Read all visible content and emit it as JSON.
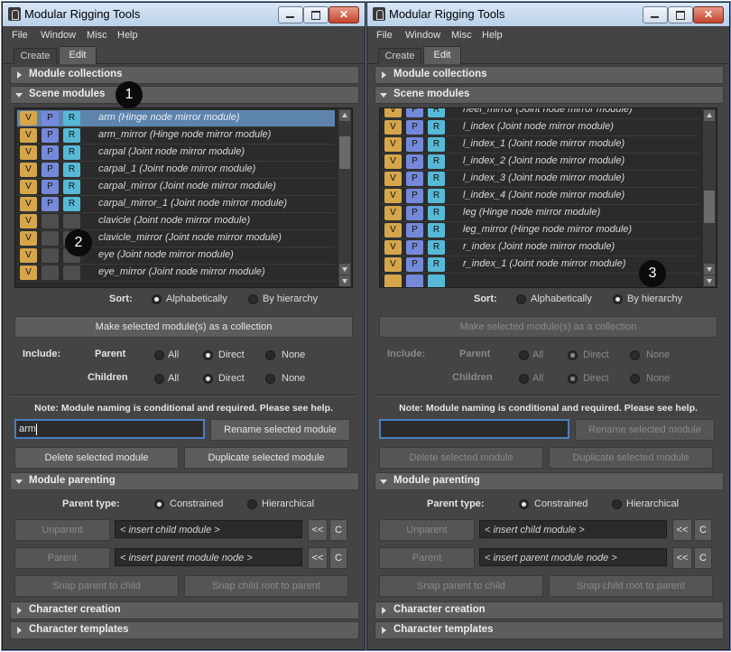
{
  "left": {
    "title": "Modular Rigging Tools",
    "menu": [
      "File",
      "Window",
      "Misc",
      "Help"
    ],
    "tabs": [
      "Create",
      "Edit"
    ],
    "sections": {
      "collections": "Module collections",
      "scene": "Scene modules",
      "parenting": "Module parenting",
      "creation": "Character creation",
      "templates": "Character templates"
    },
    "modules": [
      {
        "v": "V",
        "p": "P",
        "r": "R",
        "name": "arm (Hinge node mirror module)",
        "selected": true
      },
      {
        "v": "V",
        "p": "P",
        "r": "R",
        "name": "arm_mirror (Hinge node mirror module)"
      },
      {
        "v": "V",
        "p": "P",
        "r": "R",
        "name": "carpal (Joint node mirror module)"
      },
      {
        "v": "V",
        "p": "P",
        "r": "R",
        "name": "carpal_1 (Joint node mirror module)"
      },
      {
        "v": "V",
        "p": "P",
        "r": "R",
        "name": "carpal_mirror (Joint node mirror module)"
      },
      {
        "v": "V",
        "p": "P",
        "r": "R",
        "name": "carpal_mirror_1 (Joint node mirror module)"
      },
      {
        "v": "V",
        "p": "",
        "r": "",
        "name": "clavicle (Joint node mirror module)"
      },
      {
        "v": "V",
        "p": "",
        "r": "",
        "name": "clavicle_mirror (Joint node mirror module)"
      },
      {
        "v": "V",
        "p": "",
        "r": "",
        "name": "eye (Joint node mirror module)"
      },
      {
        "v": "V",
        "p": "",
        "r": "",
        "name": "eye_mirror (Joint node mirror module)"
      }
    ],
    "sort_label": "Sort:",
    "sort_alpha": "Alphabetically",
    "sort_hier": "By hierarchy",
    "make_collection": "Make selected module(s) as a collection",
    "include_label": "Include:",
    "parent_label": "Parent",
    "children_label": "Children",
    "opt_all": "All",
    "opt_direct": "Direct",
    "opt_none": "None",
    "note": "Note: Module naming is conditional and required. Please see help.",
    "rename_value": "arm",
    "rename_button": "Rename selected module",
    "delete_button": "Delete selected module",
    "duplicate_button": "Duplicate selected module",
    "parent_type_label": "Parent type:",
    "constrained": "Constrained",
    "hierarchical": "Hierarchical",
    "unparent": "Unparent",
    "parent": "Parent",
    "child_placeholder": "< insert child module >",
    "parent_placeholder": "< insert parent module node >",
    "btn_ltlt": "<<",
    "btn_c": "C",
    "snap_parent": "Snap parent to child",
    "snap_child": "Snap child root to parent",
    "callout_1": "1",
    "callout_2": "2"
  },
  "right": {
    "title": "Modular Rigging Tools",
    "menu": [
      "File",
      "Window",
      "Misc",
      "Help"
    ],
    "tabs": [
      "Create",
      "Edit"
    ],
    "sections": {
      "collections": "Module collections",
      "scene": "Scene modules",
      "parenting": "Module parenting",
      "creation": "Character creation",
      "templates": "Character templates"
    },
    "modules": [
      {
        "v": "V",
        "p": "P",
        "r": "R",
        "name": "heel_mirror (Joint node mirror module)"
      },
      {
        "v": "V",
        "p": "P",
        "r": "R",
        "name": "l_index (Joint node mirror module)"
      },
      {
        "v": "V",
        "p": "P",
        "r": "R",
        "name": "l_index_1 (Joint node mirror module)"
      },
      {
        "v": "V",
        "p": "P",
        "r": "R",
        "name": "l_index_2 (Joint node mirror module)"
      },
      {
        "v": "V",
        "p": "P",
        "r": "R",
        "name": "l_index_3 (Joint node mirror module)"
      },
      {
        "v": "V",
        "p": "P",
        "r": "R",
        "name": "l_index_4 (Joint node mirror module)"
      },
      {
        "v": "V",
        "p": "P",
        "r": "R",
        "name": "leg (Hinge node mirror module)"
      },
      {
        "v": "V",
        "p": "P",
        "r": "R",
        "name": "leg_mirror (Hinge node mirror module)"
      },
      {
        "v": "V",
        "p": "P",
        "r": "R",
        "name": "r_index (Joint node mirror module)"
      },
      {
        "v": "V",
        "p": "P",
        "r": "R",
        "name": "r_index_1 (Joint node mirror module)"
      }
    ],
    "sort_label": "Sort:",
    "sort_alpha": "Alphabetically",
    "sort_hier": "By hierarchy",
    "make_collection": "Make selected module(s) as a collection",
    "include_label": "Include:",
    "parent_label": "Parent",
    "children_label": "Children",
    "opt_all": "All",
    "opt_direct": "Direct",
    "opt_none": "None",
    "note": "Note: Module naming is conditional and required. Please see help.",
    "rename_value": "",
    "rename_button": "Rename selected module",
    "delete_button": "Delete selected module",
    "duplicate_button": "Duplicate selected module",
    "parent_type_label": "Parent type:",
    "constrained": "Constrained",
    "hierarchical": "Hierarchical",
    "unparent": "Unparent",
    "parent": "Parent",
    "child_placeholder": "< insert child module >",
    "parent_placeholder": "< insert parent module node >",
    "btn_ltlt": "<<",
    "btn_c": "C",
    "snap_parent": "Snap parent to child",
    "snap_child": "Snap child root to parent",
    "callout_3": "3"
  }
}
